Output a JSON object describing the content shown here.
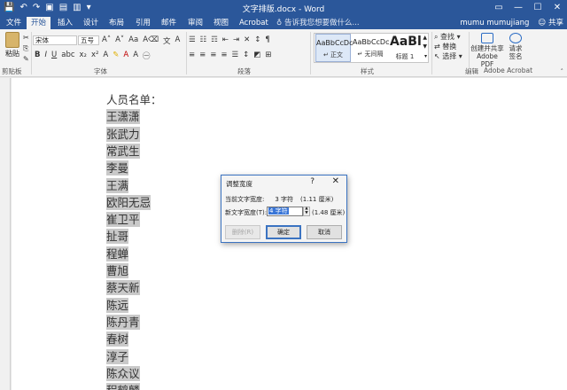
{
  "window": {
    "title": "文字排版.docx - Word",
    "controls": [
      "restore-ribbon",
      "minimize",
      "maximize",
      "close"
    ]
  },
  "quick_access": {
    "icons": [
      "save-icon",
      "undo-icon",
      "redo-icon",
      "print-preview-icon",
      "new-doc-icon",
      "open-icon",
      "customize-icon"
    ]
  },
  "tabs": [
    {
      "label": "文件",
      "active": false
    },
    {
      "label": "开始",
      "active": true
    },
    {
      "label": "插入",
      "active": false
    },
    {
      "label": "设计",
      "active": false
    },
    {
      "label": "布局",
      "active": false
    },
    {
      "label": "引用",
      "active": false
    },
    {
      "label": "邮件",
      "active": false
    },
    {
      "label": "审阅",
      "active": false
    },
    {
      "label": "视图",
      "active": false
    },
    {
      "label": "Acrobat",
      "active": false
    }
  ],
  "tell_me": "告诉我您想要做什么...",
  "user": {
    "name": "mumu mumujiang",
    "share_label": "共享"
  },
  "ribbon": {
    "clipboard": {
      "paste_label": "粘贴",
      "group_label": "剪贴板"
    },
    "font": {
      "font_name": "宋体",
      "font_size": "五号",
      "group_label": "字体"
    },
    "paragraph": {
      "group_label": "段落"
    },
    "styles": {
      "group_label": "样式",
      "items": [
        {
          "sample": "AaBbCcDc",
          "name": "正文",
          "selected": true
        },
        {
          "sample": "AaBbCcDc",
          "name": "无间隔",
          "selected": false
        },
        {
          "sample": "AaBl",
          "name": "标题 1",
          "selected": false
        }
      ]
    },
    "editing": {
      "find": "查找",
      "replace": "替换",
      "select": "选择",
      "group_label": "编辑"
    },
    "acrobat": {
      "create_label": "创建并共享 Adobe PDF",
      "request_label": "请求签名",
      "group_label": "Adobe Acrobat"
    }
  },
  "document": {
    "heading": "人员名单：",
    "names": [
      "王潇潇",
      "张武力",
      "常武生",
      "李曼",
      "王满",
      "欧阳无忌",
      "崔卫平",
      "扯哥",
      "程蝉",
      "曹旭",
      "蔡天新",
      "陈远",
      "陈丹青",
      "春树",
      "淳子",
      "陈众议",
      "程鹤麟"
    ]
  },
  "dialog": {
    "title": "调整宽度",
    "help": "?",
    "close": "✕",
    "current_label": "当前文字宽度:",
    "current_value": "3 字符",
    "current_cm": "(1.11 厘米)",
    "new_label": "新文字宽度(T):",
    "new_value": "4 字符",
    "new_cm": "(1.48 厘米)",
    "delete_button": "删除(R)",
    "ok_button": "确定",
    "cancel_button": "取消"
  }
}
